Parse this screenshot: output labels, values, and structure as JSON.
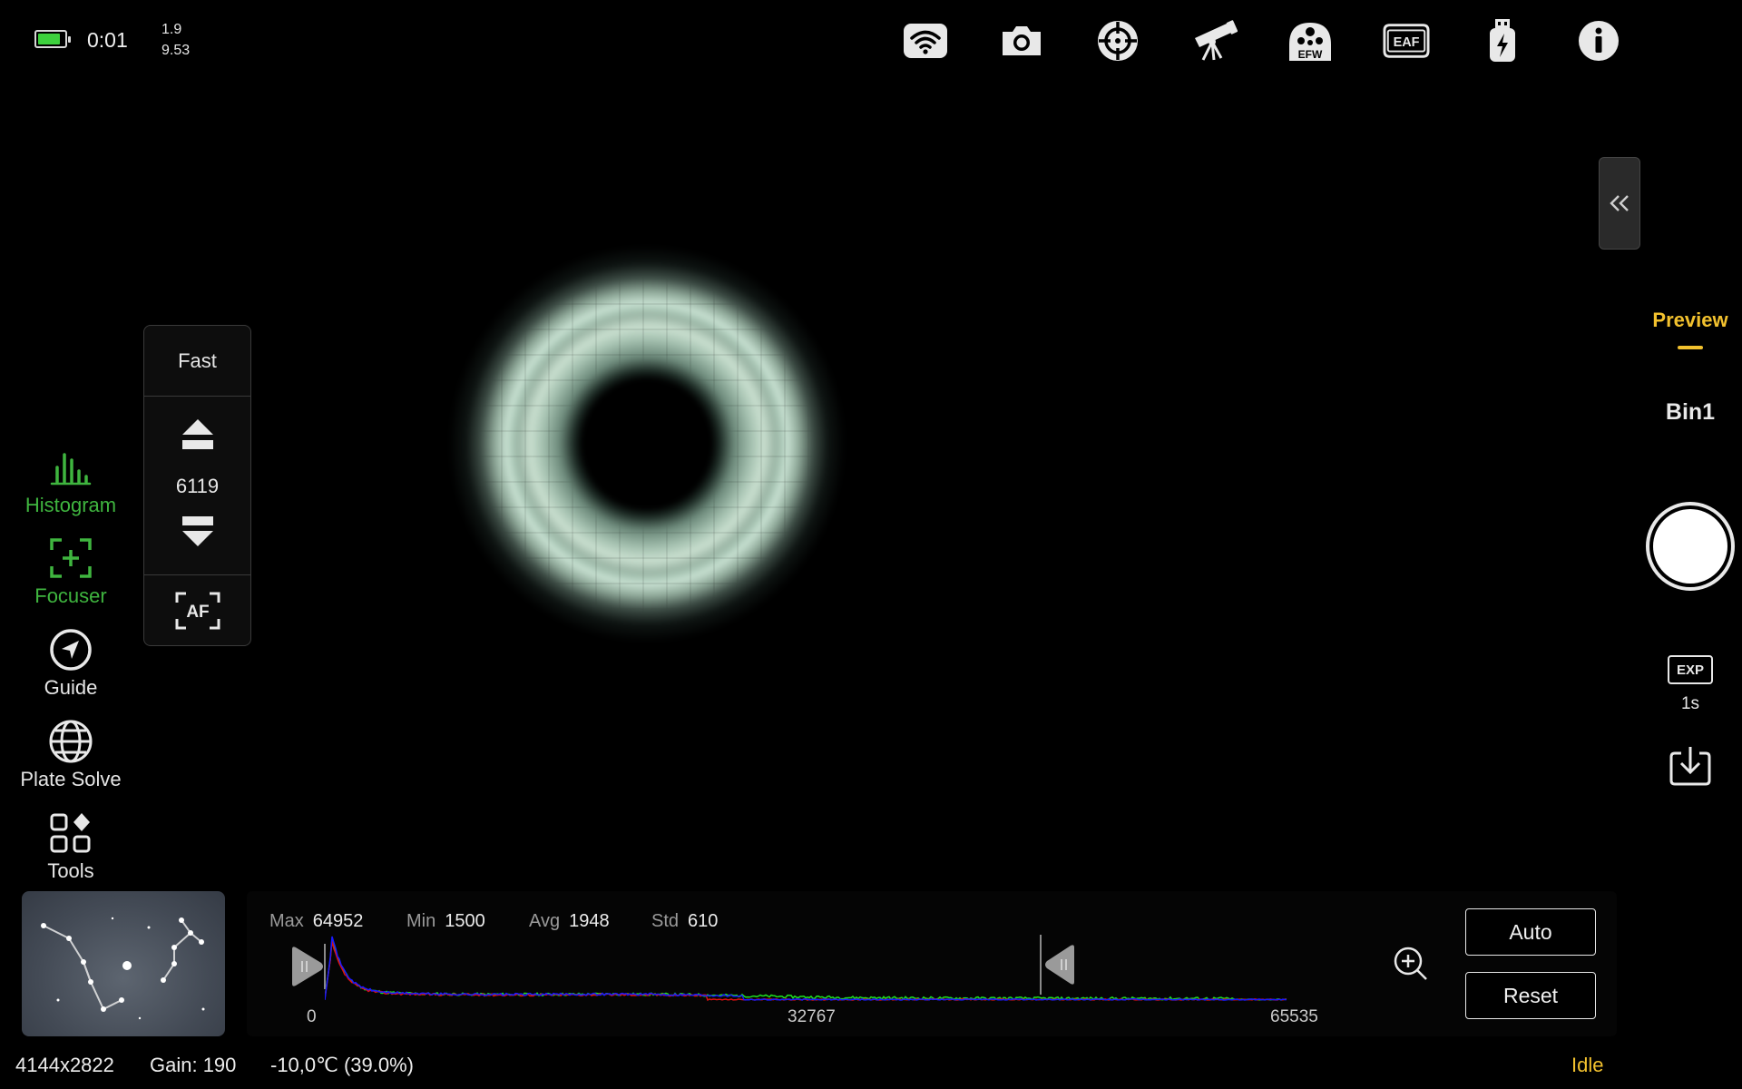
{
  "status": {
    "battery_level": 0.8,
    "battery_color": "#3dd13d",
    "time": "0:01",
    "stat_top": "1.9",
    "stat_bottom": "9.53"
  },
  "toolbar": {
    "icons": [
      "wifi-icon",
      "camera-icon",
      "target-icon",
      "telescope-icon",
      "efw-icon",
      "eaf-icon",
      "usb-icon",
      "info-icon"
    ],
    "efw_label": "EFW",
    "eaf_label": "EAF"
  },
  "left_tools": {
    "histogram": "Histogram",
    "focuser": "Focuser",
    "guide": "Guide",
    "plate_solve": "Plate Solve",
    "tools": "Tools"
  },
  "focuser_panel": {
    "speed": "Fast",
    "position": "6119",
    "af_label": "AF"
  },
  "right_panel": {
    "mode": "Preview",
    "bin": "Bin1",
    "exp_label": "EXP",
    "exp_value": "1s"
  },
  "histogram": {
    "max_label": "Max",
    "max_value": "64952",
    "min_label": "Min",
    "min_value": "1500",
    "avg_label": "Avg",
    "avg_value": "1948",
    "std_label": "Std",
    "std_value": "610",
    "axis": [
      "0",
      "32767",
      "65535"
    ],
    "auto_label": "Auto",
    "reset_label": "Reset",
    "colors": {
      "red": "#e01010",
      "green": "#1fe01f",
      "blue": "#1a1aff"
    }
  },
  "footer": {
    "resolution": "4144x2822",
    "gain": "Gain: 190",
    "temperature": "-10,0℃  (39.0%)",
    "state": "Idle",
    "accent": "#f2c12e"
  }
}
